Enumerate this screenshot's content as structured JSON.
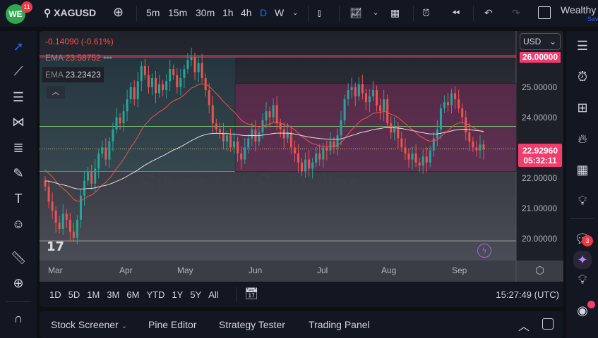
{
  "topbar": {
    "logo": "WE",
    "notif_count": "11",
    "symbol": "XAGUSD",
    "intervals": [
      "5m",
      "15m",
      "30m",
      "1h",
      "4h",
      "D",
      "W"
    ],
    "active_interval": "D",
    "account": "Wealthy",
    "account_sub": "Save"
  },
  "legend": {
    "change": "-0.14090 (-0.61%)",
    "ema1_label": "EMA",
    "ema1_value": "23.58752",
    "ema2_label": "EMA",
    "ema2_value": "23.23423",
    "more": "•••"
  },
  "watermark": "Silver / U.S. Dollar",
  "currency": "USD",
  "price_axis": [
    "25.00000",
    "24.00000",
    "22.00000",
    "21.00000",
    "20.00000"
  ],
  "level_label": "26.00000",
  "last_price": "22.92960",
  "countdown": "05:32:11",
  "time_axis": [
    "Mar",
    "Apr",
    "May",
    "Jun",
    "Jul",
    "Aug",
    "Sep"
  ],
  "ranges": [
    "1D",
    "5D",
    "1M",
    "3M",
    "6M",
    "YTD",
    "1Y",
    "5Y",
    "All"
  ],
  "clock": "15:27:49 (UTC)",
  "bottom_tabs": [
    "Stock Screener",
    "Pine Editor",
    "Strategy Tester",
    "Trading Panel"
  ],
  "right_badge": "3",
  "colors": {
    "up": "#26a69a",
    "down": "#ef5350",
    "accent": "#2962ff",
    "level": "#f23d6d"
  },
  "chart_data": {
    "type": "candlestick",
    "ylim": [
      19.4,
      26.6
    ],
    "closes": [
      21.7,
      21.2,
      20.9,
      20.5,
      20.3,
      20.8,
      20.6,
      20.2,
      20.0,
      20.6,
      21.4,
      21.9,
      22.2,
      21.8,
      22.3,
      22.8,
      23.0,
      22.6,
      23.2,
      23.6,
      24.0,
      23.8,
      24.2,
      24.6,
      25.0,
      24.6,
      25.2,
      25.7,
      25.4,
      25.0,
      25.3,
      24.8,
      25.1,
      24.9,
      25.2,
      25.6,
      25.4,
      25.0,
      25.3,
      25.6,
      25.9,
      26.0,
      25.5,
      25.8,
      25.3,
      24.9,
      24.4,
      23.8,
      23.6,
      23.5,
      23.2,
      23.4,
      23.0,
      23.2,
      22.8,
      22.6,
      23.0,
      23.3,
      23.6,
      23.2,
      23.5,
      23.9,
      24.2,
      24.0,
      24.4,
      23.8,
      23.6,
      23.3,
      23.5,
      23.0,
      22.8,
      22.5,
      22.2,
      22.6,
      22.3,
      22.5,
      22.8,
      22.6,
      23.0,
      22.9,
      23.2,
      23.0,
      23.4,
      23.9,
      24.6,
      24.9,
      25.0,
      24.7,
      25.1,
      24.8,
      24.5,
      24.7,
      24.9,
      24.4,
      24.2,
      24.6,
      23.8,
      23.5,
      23.7,
      23.3,
      23.0,
      22.8,
      22.6,
      22.8,
      22.5,
      22.4,
      22.7,
      22.5,
      22.9,
      23.3,
      23.6,
      24.3,
      24.5,
      24.4,
      24.8,
      24.6,
      24.3,
      24.0,
      23.5,
      23.2,
      23.0,
      22.9,
      23.1,
      22.93
    ],
    "ema_fast": "50",
    "ema_slow": "200",
    "levels": [
      26.0,
      23.7,
      22.95,
      22.2,
      19.9
    ],
    "rectangle": [
      25.13,
      22.2
    ]
  }
}
